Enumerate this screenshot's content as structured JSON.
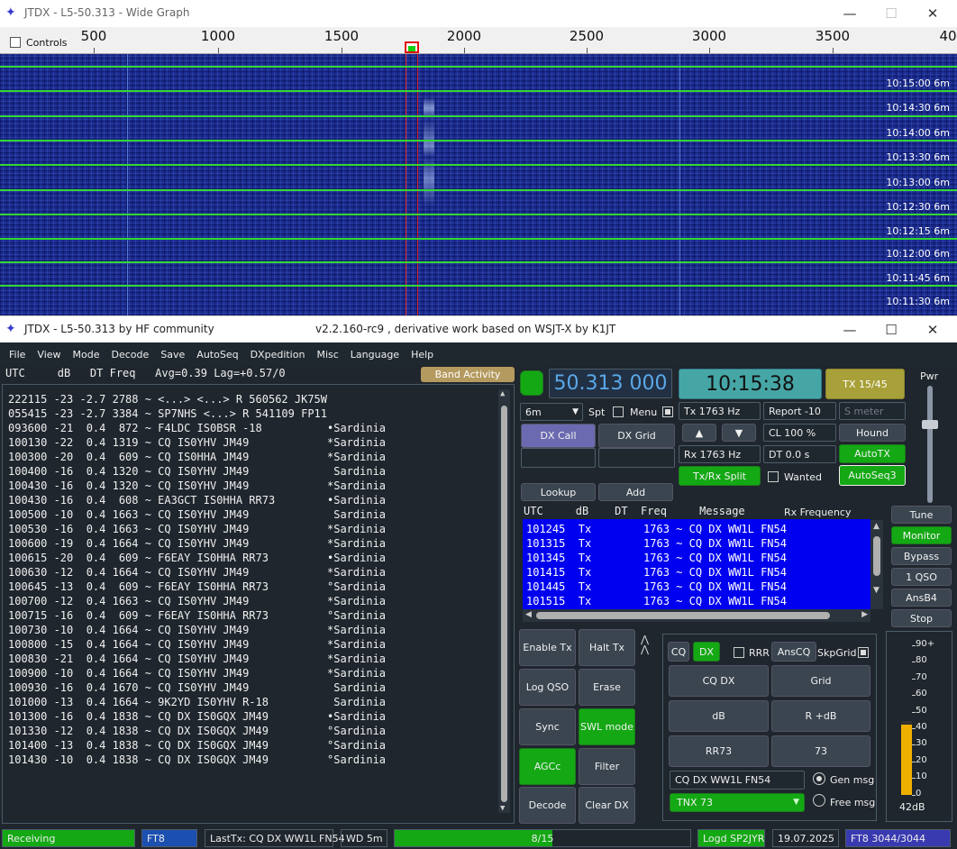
{
  "wide_graph": {
    "title": "JTDX - L5-50.313 - Wide Graph",
    "controls_label": "Controls",
    "ticks": [
      "500",
      "1000",
      "1500",
      "2000",
      "2500",
      "3000",
      "3500",
      "40"
    ],
    "time_labels": [
      "10:15:00  6m",
      "10:14:30  6m",
      "10:14:00  6m",
      "10:13:30  6m",
      "10:13:00  6m",
      "10:12:30  6m",
      "10:12:15  6m",
      "10:12:00  6m",
      "10:11:45  6m",
      "10:11:30  6m"
    ]
  },
  "main": {
    "title": "JTDX - L5-50.313  by HF community",
    "version": "v2.2.160-rc9 , derivative work based on WSJT-X by K1JT"
  },
  "menu": [
    "File",
    "View",
    "Mode",
    "Decode",
    "Save",
    "AutoSeq",
    "DXpedition",
    "Misc",
    "Language",
    "Help"
  ],
  "left_header": "UTC     dB   DT Freq   Avg=0.39 Lag=+0.57/0",
  "band_activity": "Band Activity",
  "decodes": [
    "222115 -23 -2.7 2788 ~ <...> <...> R 560562 JK75W",
    "055415 -23 -2.7 3384 ~ SP7NHS <...> R 541109 FP11",
    "093600 -21  0.4  872 ~ F4LDC IS0BSR -18          •Sardinia",
    "100130 -22  0.4 1319 ~ CQ IS0YHV JM49            *Sardinia",
    "100300 -20  0.4  609 ~ CQ IS0HHA JM49            *Sardinia",
    "100400 -16  0.4 1320 ~ CQ IS0YHV JM49             Sardinia",
    "100430 -16  0.4 1320 ~ CQ IS0YHV JM49            *Sardinia",
    "100430 -16  0.4  608 ~ EA3GCT IS0HHA RR73        •Sardinia",
    "100500 -10  0.4 1663 ~ CQ IS0YHV JM49             Sardinia",
    "100530 -16  0.4 1663 ~ CQ IS0YHV JM49            *Sardinia",
    "100600 -19  0.4 1664 ~ CQ IS0YHV JM49            *Sardinia",
    "100615 -20  0.4  609 ~ F6EAY IS0HHA RR73         •Sardinia",
    "100630 -12  0.4 1664 ~ CQ IS0YHV JM49            *Sardinia",
    "100645 -13  0.4  609 ~ F6EAY IS0HHA RR73         °Sardinia",
    "100700 -12  0.4 1663 ~ CQ IS0YHV JM49            *Sardinia",
    "100715 -16  0.4  609 ~ F6EAY IS0HHA RR73         °Sardinia",
    "100730 -10  0.4 1664 ~ CQ IS0YHV JM49            *Sardinia",
    "100800 -15  0.4 1664 ~ CQ IS0YHV JM49            *Sardinia",
    "100830 -21  0.4 1664 ~ CQ IS0YHV JM49            *Sardinia",
    "100900 -10  0.4 1664 ~ CQ IS0YHV JM49            *Sardinia",
    "100930 -16  0.4 1670 ~ CQ IS0YHV JM49             Sardinia",
    "101000 -13  0.4 1664 ~ 9K2YD IS0YHV R-18          Sardinia",
    "101300 -16  0.4 1838 ~ CQ DX IS0GQX JM49         •Sardinia",
    "101330 -12  0.4 1838 ~ CQ DX IS0GQX JM49         °Sardinia",
    "101400 -13  0.4 1838 ~ CQ DX IS0GQX JM49         °Sardinia",
    "101430 -10  0.4 1838 ~ CQ DX IS0GQX JM49         °Sardinia"
  ],
  "dial_freq": "50.313 000",
  "clock": "10:15:38",
  "tx_slot": "TX 15/45",
  "pwr_label": "Pwr",
  "band": "6m",
  "spt": "Spt",
  "menu_cb": "Menu",
  "tx_freq": "Tx  1763  Hz",
  "rx_freq": "Rx  1763  Hz",
  "report": "Report -10",
  "s_meter": "S meter",
  "cl": "CL  100 %",
  "dt": "DT 0.0 s",
  "buttons": {
    "dx_call": "DX Call",
    "dx_grid": "DX Grid",
    "hound": "Hound",
    "autotx": "AutoTX",
    "txrx_split": "Tx/Rx Split",
    "wanted": "Wanted",
    "autoseq3": "AutoSeq3",
    "lookup": "Lookup",
    "add": "Add",
    "tune": "Tune",
    "monitor": "Monitor",
    "bypass": "Bypass",
    "one_qso": "1 QSO",
    "ansb4": "AnsB4",
    "stop": "Stop",
    "enable_tx": "Enable Tx",
    "halt_tx": "Halt Tx",
    "log_qso": "Log QSO",
    "erase": "Erase",
    "sync": "Sync",
    "swl_mode": "SWL mode",
    "agcc": "AGCc",
    "filter": "Filter",
    "decode": "Decode",
    "clear_dx": "Clear DX",
    "cq": "CQ",
    "dx": "DX",
    "rrr": "RRR",
    "anscq": "AnsCQ",
    "skpgrid": "SkpGrid",
    "cq_dx": "CQ DX",
    "grid": "Grid",
    "db": "dB",
    "r_db": "R +dB",
    "rr73": "RR73",
    "n73": "73",
    "gen_msg": "Gen msg",
    "free_msg": "Free msg"
  },
  "rx_header": "UTC     dB    DT  Freq     Message",
  "rx_freq_header": "Rx Frequency",
  "tx_history": [
    "101245  Tx        1763 ~ CQ DX WW1L FN54",
    "101315  Tx        1763 ~ CQ DX WW1L FN54",
    "101345  Tx        1763 ~ CQ DX WW1L FN54",
    "101415  Tx        1763 ~ CQ DX WW1L FN54",
    "101445  Tx        1763 ~ CQ DX WW1L FN54",
    "101515  Tx        1763 ~ CQ DX WW1L FN54"
  ],
  "gen_message": "CQ DX WW1L FN54",
  "free_message": "TNX 73",
  "meter": {
    "scale": [
      "90+",
      "80",
      "70",
      "60",
      "50",
      "40",
      "30",
      "20",
      "10",
      "0"
    ],
    "level_db": "42dB",
    "level_value": 42
  },
  "status": {
    "mode": "Receiving",
    "proto": "FT8",
    "last_tx": "LastTx: CQ DX WW1L FN54",
    "wd": "WD 5m",
    "progress": "8/15",
    "progress_fraction": 0.533,
    "logd": "Logd SP2JYR",
    "date": "19.07.2025",
    "ft8_count": "FT8  3044/3044"
  }
}
